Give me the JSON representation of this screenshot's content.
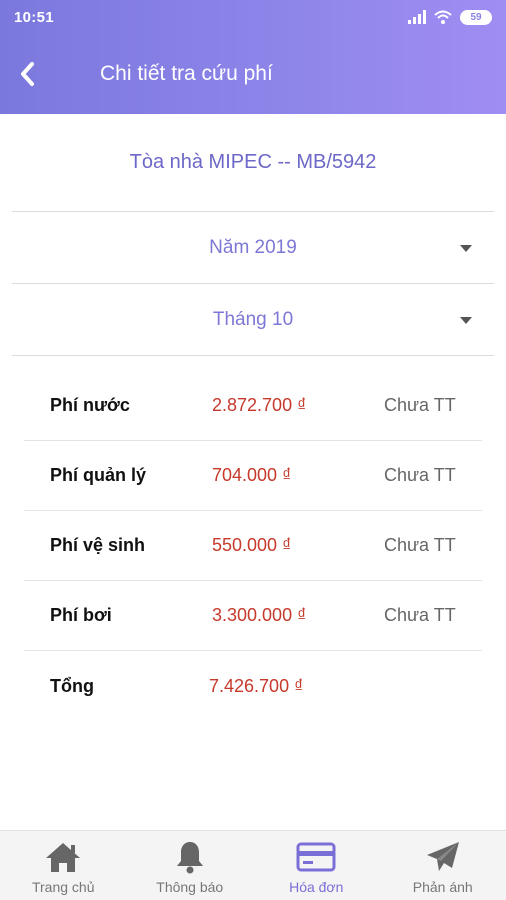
{
  "status_bar": {
    "time": "10:51",
    "battery": "59"
  },
  "header": {
    "title": "Chi tiết tra cứu phí",
    "back_icon": "chevron-left-icon"
  },
  "building": "Tòa nhà MIPEC -- MB/5942",
  "filters": {
    "year": "Năm 2019",
    "month": "Tháng 10"
  },
  "fees": [
    {
      "name": "Phí nước",
      "amount": "2.872.700 ₫",
      "status": "Chưa TT"
    },
    {
      "name": "Phí quản lý",
      "amount": "704.000 ₫",
      "status": "Chưa TT"
    },
    {
      "name": "Phí vệ sinh",
      "amount": "550.000 ₫",
      "status": "Chưa TT"
    },
    {
      "name": "Phí bơi",
      "amount": "3.300.000 ₫",
      "status": "Chưa TT"
    }
  ],
  "total": {
    "label": "Tổng",
    "amount": "7.426.700 ₫"
  },
  "bottom_nav": [
    {
      "label": "Trang chủ",
      "icon": "home-icon",
      "active": false
    },
    {
      "label": "Thông báo",
      "icon": "bell-icon",
      "active": false
    },
    {
      "label": "Hóa đơn",
      "icon": "card-icon",
      "active": true
    },
    {
      "label": "Phản ánh",
      "icon": "send-icon",
      "active": false
    }
  ],
  "colors": {
    "accent": "#8a82e6",
    "amount": "#c6392b",
    "nav_inactive": "#777777"
  }
}
